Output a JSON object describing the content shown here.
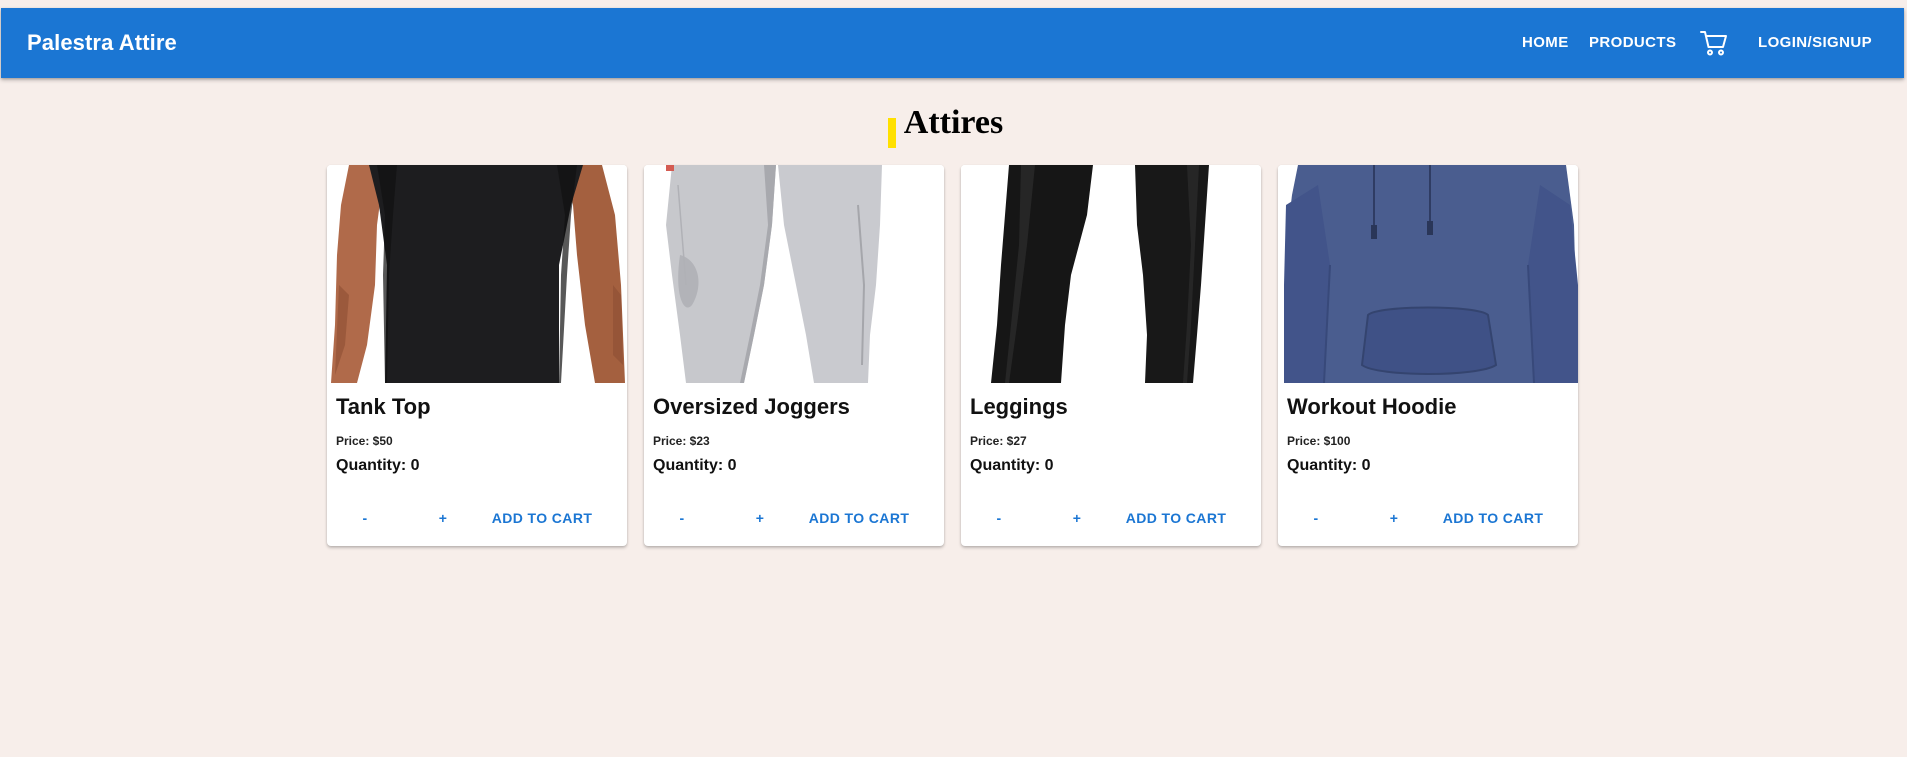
{
  "header": {
    "brand": "Palestra Attire",
    "nav": {
      "home": "HOME",
      "products": "PRODUCTS",
      "cart_icon": "cart-icon",
      "login": "LOGIN/SIGNUP"
    }
  },
  "page": {
    "title": "Attires"
  },
  "products": [
    {
      "name": "Tank Top",
      "price": "Price: $50",
      "quantity": "Quantity: 0",
      "image": "tank-top-image",
      "minus": "-",
      "plus": "+",
      "add": "ADD TO CART"
    },
    {
      "name": "Oversized Joggers",
      "price": "Price: $23",
      "quantity": "Quantity: 0",
      "image": "joggers-image",
      "minus": "-",
      "plus": "+",
      "add": "ADD TO CART"
    },
    {
      "name": "Leggings",
      "price": "Price: $27",
      "quantity": "Quantity: 0",
      "image": "leggings-image",
      "minus": "-",
      "plus": "+",
      "add": "ADD TO CART"
    },
    {
      "name": "Workout Hoodie",
      "price": "Price: $100",
      "quantity": "Quantity: 0",
      "image": "hoodie-image",
      "minus": "-",
      "plus": "+",
      "add": "ADD TO CART"
    }
  ],
  "colors": {
    "appbar": "#1b76d3",
    "background": "#f7eeea",
    "accent_marker": "#ffe000",
    "button_text": "#1b76d3"
  }
}
